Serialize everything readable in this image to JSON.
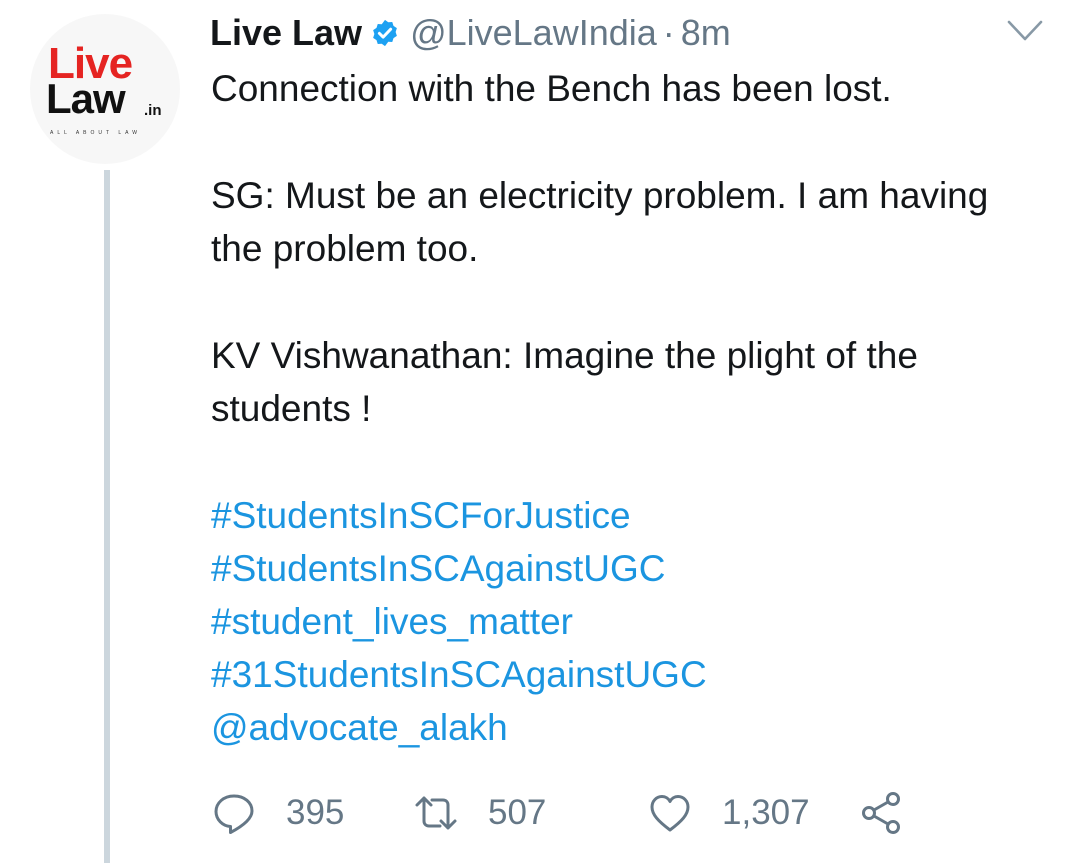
{
  "author": {
    "name": "Live Law",
    "handle": "@LiveLawIndia",
    "separator": "·",
    "time": "8m",
    "verified": true,
    "avatar": {
      "line1": "Live",
      "line2": "Law",
      "suffix": ".in",
      "tagline": "ALL ABOUT LAW",
      "brand_red": "#e52422"
    }
  },
  "tweet": {
    "paragraphs": [
      "Connection with the Bench has been lost.",
      "SG: Must be an electricity problem. I am having the problem too.",
      "KV Vishwanathan: Imagine the plight of the students !"
    ],
    "links": [
      "#StudentsInSCForJustice",
      "#StudentsInSCAgainstUGC",
      "#student_lives_matter",
      "#31StudentsInSCAgainstUGC",
      "@advocate_alakh"
    ]
  },
  "actions": {
    "replies": "395",
    "retweets": "507",
    "likes": "1,307"
  },
  "icons": {
    "reply": "reply-icon",
    "retweet": "retweet-icon",
    "like": "heart-icon",
    "share": "share-icon",
    "verified": "verified-badge-icon",
    "menu": "chevron-down-icon"
  },
  "colors": {
    "link": "#1b95e0",
    "secondary_text": "#657786",
    "verified": "#1da1f2"
  }
}
